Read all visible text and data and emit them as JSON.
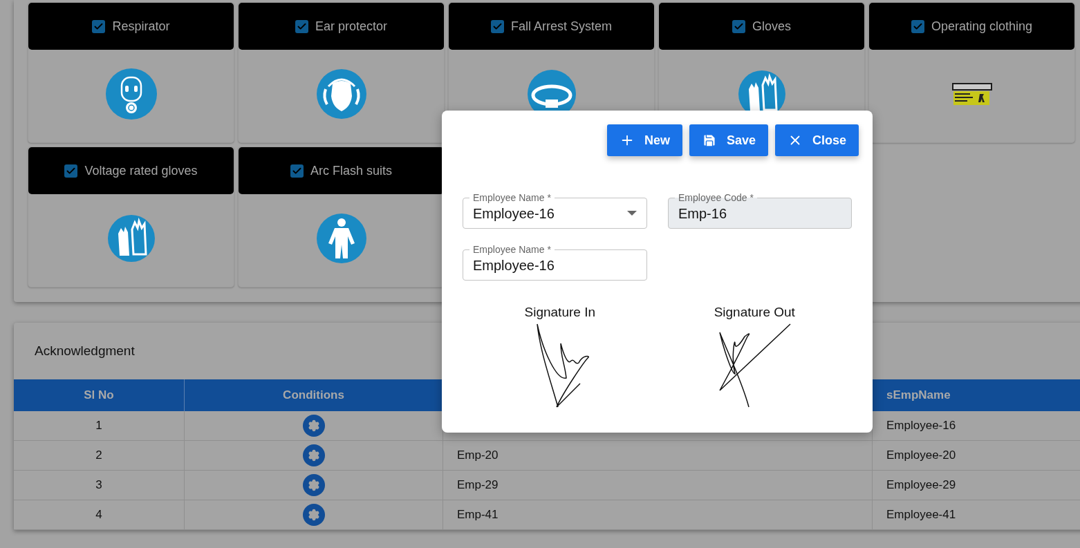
{
  "ppe_items": [
    {
      "label": "Respirator",
      "checked": true,
      "kind": "respirator"
    },
    {
      "label": "Ear protector",
      "checked": true,
      "kind": "ear"
    },
    {
      "label": "Fall Arrest System",
      "checked": true,
      "kind": "harness"
    },
    {
      "label": "Gloves",
      "checked": true,
      "kind": "gloves"
    },
    {
      "label": "Operating clothing",
      "checked": true,
      "kind": "picture"
    },
    {
      "label": "Voltage rated gloves",
      "checked": true,
      "kind": "gloves"
    },
    {
      "label": "Arc Flash suits",
      "checked": true,
      "kind": "suit"
    }
  ],
  "acknowledgment": {
    "title": "Acknowledgment",
    "columns": {
      "column_1": "Sl No",
      "column_2": "Conditions",
      "column_4": "sEmpName"
    },
    "rows": [
      {
        "sl_no": "1",
        "name": "Employee-16"
      },
      {
        "sl_no": "2",
        "code": "Emp-20",
        "name": "Employee-20"
      },
      {
        "sl_no": "3",
        "code": "Emp-29",
        "name": "Employee-29"
      },
      {
        "sl_no": "4",
        "code": "Emp-41",
        "name": "Employee-41"
      }
    ]
  },
  "dialog": {
    "buttons": [
      {
        "label": "New",
        "kind": "new"
      },
      {
        "label": "Save",
        "kind": "save"
      },
      {
        "label": "Close",
        "kind": "close"
      }
    ],
    "fields": [
      {
        "label": "Employee Name *",
        "value": "Employee-16",
        "kind": "select",
        "disabled": false
      },
      {
        "label": "Employee Code *",
        "value": "Emp-16",
        "kind": "text",
        "disabled": true
      },
      {
        "label": "Employee Name *",
        "value": "Employee-16",
        "kind": "text",
        "disabled": false
      }
    ],
    "signatures": [
      {
        "label": "Signature In"
      },
      {
        "label": "Signature Out"
      }
    ]
  }
}
